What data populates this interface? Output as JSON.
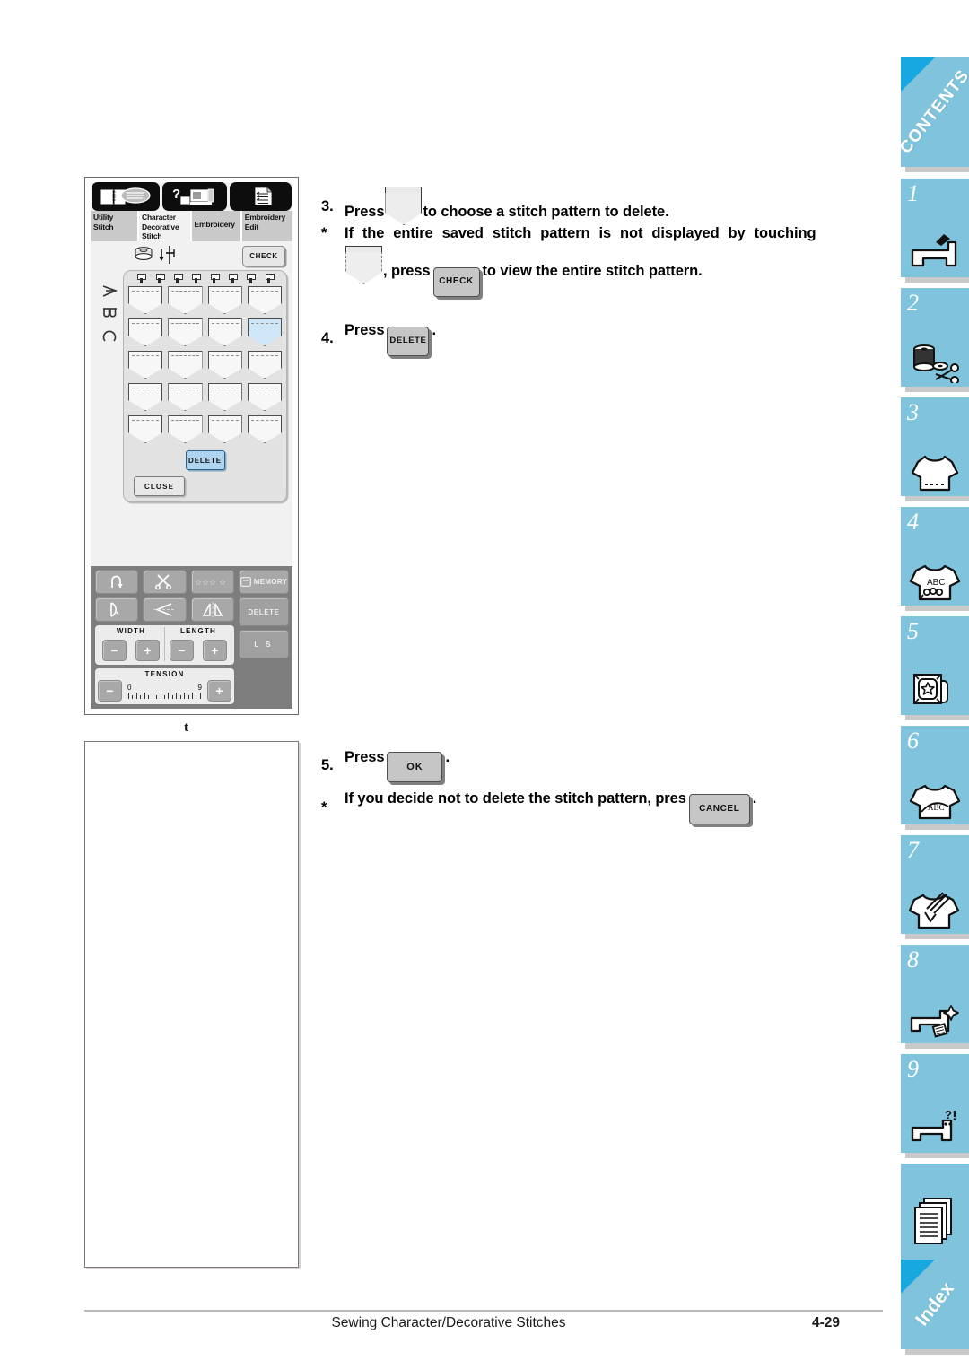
{
  "document": {
    "footer_title": "Sewing Character/Decorative Stitches",
    "footer_page": "4-29",
    "stray_mark": "t"
  },
  "instructions": [
    {
      "id": "step3",
      "marker": "3.",
      "text_before": "Press",
      "glyph": "pocket-icon",
      "text_after": "to choose a stitch pattern to delete."
    },
    {
      "id": "note1",
      "marker": "*",
      "text_line1": "If the entire saved stitch pattern is not displayed by touching",
      "glyph1": "pocket-icon",
      "text_mid": ", press",
      "glyph2": "CHECK",
      "text_after": "to view the entire stitch pattern."
    },
    {
      "id": "step4",
      "marker": "4.",
      "text_before": "Press",
      "glyph": "DELETE",
      "text_after": "."
    },
    {
      "id": "step5",
      "marker": "5.",
      "text_before": "Press",
      "glyph": "OK",
      "text_after": "."
    },
    {
      "id": "note2",
      "marker": "*",
      "text_before": "If you decide not to delete the stitch pattern, pres",
      "glyph": "CANCEL",
      "text_after": "."
    }
  ],
  "inline_buttons": {
    "check": "CHECK",
    "delete": "DELETE",
    "ok": "OK",
    "cancel": "CANCEL"
  },
  "lcd": {
    "tabs": [
      {
        "label": "Utility\nStitch",
        "line1": "Utility",
        "line2": "Stitch",
        "line3": "",
        "active": false
      },
      {
        "label": "Character Decorative Stitch",
        "line1": "Character",
        "line2": "Decorative",
        "line3": "Stitch",
        "active": true
      },
      {
        "label": "Embroidery",
        "line1": "Embroidery",
        "line2": "",
        "line3": "",
        "active": false
      },
      {
        "label": "Embroidery Edit",
        "line1": "Embroidery",
        "line2": "Edit",
        "line3": "",
        "active": false
      }
    ],
    "top_icons": [
      "manual-book-icon",
      "help-machine-icon",
      "settings-list-icon"
    ],
    "check_button": "CHECK",
    "side_letters": [
      "A",
      "B",
      "C"
    ],
    "pocket_grid": {
      "rows": 5,
      "cols": 4,
      "selected_index": 7
    },
    "delete_button": "DELETE",
    "close_button": "CLOSE",
    "controls": {
      "icon_buttons": [
        "reverse-stitch-icon",
        "thread-cutter-icon",
        "auto-stitch-icon",
        "needle-position-icon",
        "single-pattern-icon",
        "mirror-horizontal-icon",
        "mirror-vertical-icon"
      ],
      "memory_button": "MEMORY",
      "width_label": "WIDTH",
      "length_label": "LENGTH",
      "tension_label": "TENSION",
      "tension_min": "0",
      "tension_max": "9",
      "minus": "−",
      "plus": "+",
      "delete_button": "DELETE",
      "ls_button": "L  S"
    }
  },
  "index_tabs": [
    {
      "id": "contents",
      "label": "CONTENTS",
      "number": "",
      "icon": "",
      "corner": true
    },
    {
      "id": "ch1",
      "label": "",
      "number": "1",
      "icon": "sewing-machine-icon",
      "corner": false
    },
    {
      "id": "ch2",
      "label": "",
      "number": "2",
      "icon": "spool-scissors-icon",
      "corner": false
    },
    {
      "id": "ch3",
      "label": "",
      "number": "3",
      "icon": "tshirt-stitch-icon",
      "corner": false
    },
    {
      "id": "ch4",
      "label": "",
      "number": "4",
      "icon": "tshirt-abc-icon",
      "corner": false
    },
    {
      "id": "ch5",
      "label": "",
      "number": "5",
      "icon": "embroidery-card-star-icon",
      "corner": false
    },
    {
      "id": "ch6",
      "label": "",
      "number": "6",
      "icon": "tshirt-abc-edit-icon",
      "corner": false
    },
    {
      "id": "ch7",
      "label": "",
      "number": "7",
      "icon": "tshirt-needle-icon",
      "corner": false
    },
    {
      "id": "ch8",
      "label": "",
      "number": "8",
      "icon": "machine-maintenance-icon",
      "corner": false
    },
    {
      "id": "ch9",
      "label": "",
      "number": "9",
      "icon": "machine-troubleshoot-icon",
      "corner": false
    },
    {
      "id": "appendix",
      "label": "",
      "number": "",
      "icon": "documents-icon",
      "corner": false
    },
    {
      "id": "index",
      "label": "Index",
      "number": "",
      "icon": "",
      "corner": true
    }
  ],
  "colors": {
    "tab_blue": "#7fc3dc",
    "corner_blue": "#17a8e0",
    "tab_shadow": "#c9c9c9",
    "lcd_bg": "#f1f1f1",
    "lcd_control_bar": "#7d7d7d",
    "selected_pocket": "#cfe6f7",
    "lcd_delete_blue": "#aed4ef"
  }
}
